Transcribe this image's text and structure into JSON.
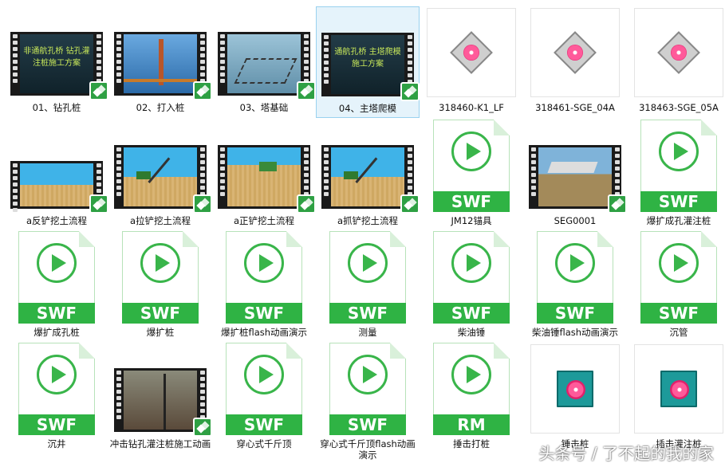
{
  "files": [
    {
      "name": "01、钻孔桩",
      "kind": "video",
      "scene": "dark-title",
      "overlay": "非通航孔桥 钻孔灌注桩施工方案"
    },
    {
      "name": "02、打入桩",
      "kind": "video",
      "scene": "sea-tower"
    },
    {
      "name": "03、塔基础",
      "kind": "video",
      "scene": "sea-grid"
    },
    {
      "name": "04、主塔爬模",
      "kind": "video",
      "scene": "dark-title",
      "overlay": "通航孔桥 主塔爬模施工方案",
      "selected": true
    },
    {
      "name": "318460-K1_LF",
      "kind": "gem"
    },
    {
      "name": "318461-SGE_04A",
      "kind": "gem"
    },
    {
      "name": "318463-SGE_05A",
      "kind": "gem"
    },
    {
      "name": "a反铲挖土流程",
      "kind": "video",
      "scene": "sand"
    },
    {
      "name": "a拉铲挖土流程",
      "kind": "video",
      "scene": "sand-crane"
    },
    {
      "name": "a正铲挖土流程",
      "kind": "video",
      "scene": "sand-pit"
    },
    {
      "name": "a抓铲挖土流程",
      "kind": "video",
      "scene": "sand-crane"
    },
    {
      "name": "JM12锚具",
      "kind": "doc",
      "badge": "SWF"
    },
    {
      "name": "SEG0001",
      "kind": "video",
      "scene": "segment"
    },
    {
      "name": "爆扩成孔灌注桩",
      "kind": "doc",
      "badge": "SWF"
    },
    {
      "name": "爆扩成孔桩",
      "kind": "doc",
      "badge": "SWF"
    },
    {
      "name": "爆扩桩",
      "kind": "doc",
      "badge": "SWF"
    },
    {
      "name": "爆扩桩flash动画演示",
      "kind": "doc",
      "badge": "SWF"
    },
    {
      "name": "测量",
      "kind": "doc",
      "badge": "SWF"
    },
    {
      "name": "柴油锤",
      "kind": "doc",
      "badge": "SWF"
    },
    {
      "name": "柴油锤flash动画演示",
      "kind": "doc",
      "badge": "SWF"
    },
    {
      "name": "沉管",
      "kind": "doc",
      "badge": "SWF"
    },
    {
      "name": "沉井",
      "kind": "doc",
      "badge": "SWF"
    },
    {
      "name": "冲击钻孔灌注桩施工动画",
      "kind": "video",
      "scene": "site"
    },
    {
      "name": "穿心式千斤顶",
      "kind": "doc",
      "badge": "SWF"
    },
    {
      "name": "穿心式千斤顶flash动画演示",
      "kind": "doc",
      "badge": "SWF"
    },
    {
      "name": "捶击打桩",
      "kind": "doc",
      "badge": "RM"
    },
    {
      "name": "锤击桩",
      "kind": "gem-teal"
    },
    {
      "name": "插击灌注桩",
      "kind": "gem-teal"
    }
  ],
  "watermark": "头条号 / 了不起的我的家",
  "colors": {
    "accent": "#2fb344",
    "selection": "#e5f3fb"
  }
}
